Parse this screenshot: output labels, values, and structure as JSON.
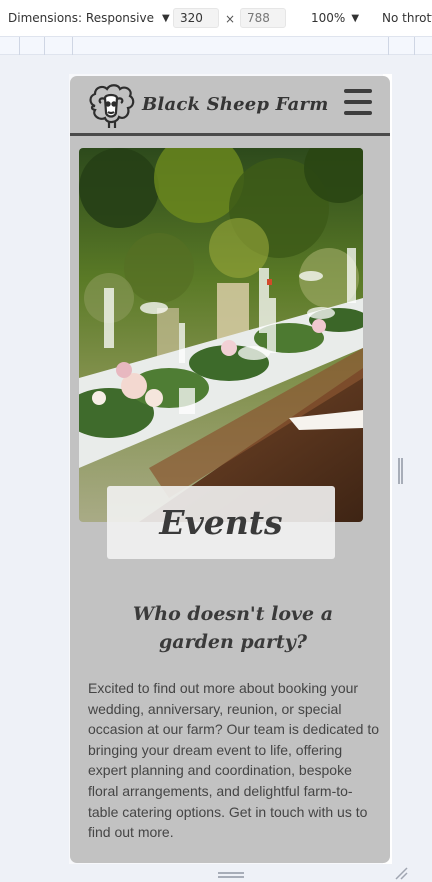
{
  "devtools": {
    "dimensions_label": "Dimensions: Responsive",
    "width_value": "320",
    "x_separator": "×",
    "height_value": "788",
    "zoom_label": "100%",
    "throttle_label": "No thrott"
  },
  "site": {
    "brand_name": "Black Sheep Farm",
    "hero_title": "Events",
    "subheading": "Who doesn't love a garden party?",
    "body_text": "Excited to find out more about booking your wedding, anniversary, reunion, or special occasion at our farm? Our team is dedicated to bringing your dream event to life, offering expert planning and coordination, bespoke floral arrangements, and delightful farm-to-table catering options. Get in touch with us to find out more."
  },
  "icons": {
    "logo": "sheep-logo-icon",
    "menu": "hamburger-menu-icon",
    "dropdown": "triangle-down-icon"
  },
  "colors": {
    "site_background": "#c2c2c2",
    "header_rule": "#4a4a4a",
    "text": "#3a3a3a"
  }
}
